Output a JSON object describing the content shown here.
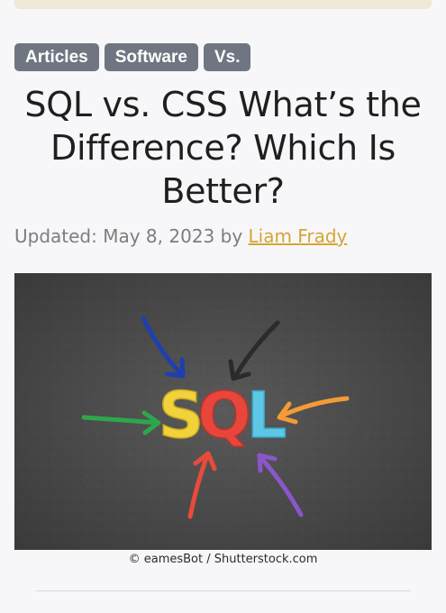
{
  "tags": [
    "Articles",
    "Software",
    "Vs."
  ],
  "article": {
    "title": "SQL vs. CSS What’s the Difference? Which Is Better?",
    "updated_prefix": "Updated: May 8, 2023 by ",
    "author": "Liam Frady"
  },
  "hero": {
    "letters": [
      "S",
      "Q",
      "L"
    ],
    "letter_colors": [
      "#f2d23a",
      "#e8463c",
      "#5ec7e6"
    ],
    "arrow_colors": [
      "#1f3fae",
      "#2b2b2b",
      "#f59a36",
      "#8a56c9",
      "#e84b3a",
      "#2fa64b"
    ],
    "background_color": "#4a4a4a",
    "credit": "© eamesBot / Shutterstock.com"
  },
  "colors": {
    "tag_background": "#6f7681",
    "author_link": "#d4a634",
    "page_background": "#f7f7f9"
  }
}
